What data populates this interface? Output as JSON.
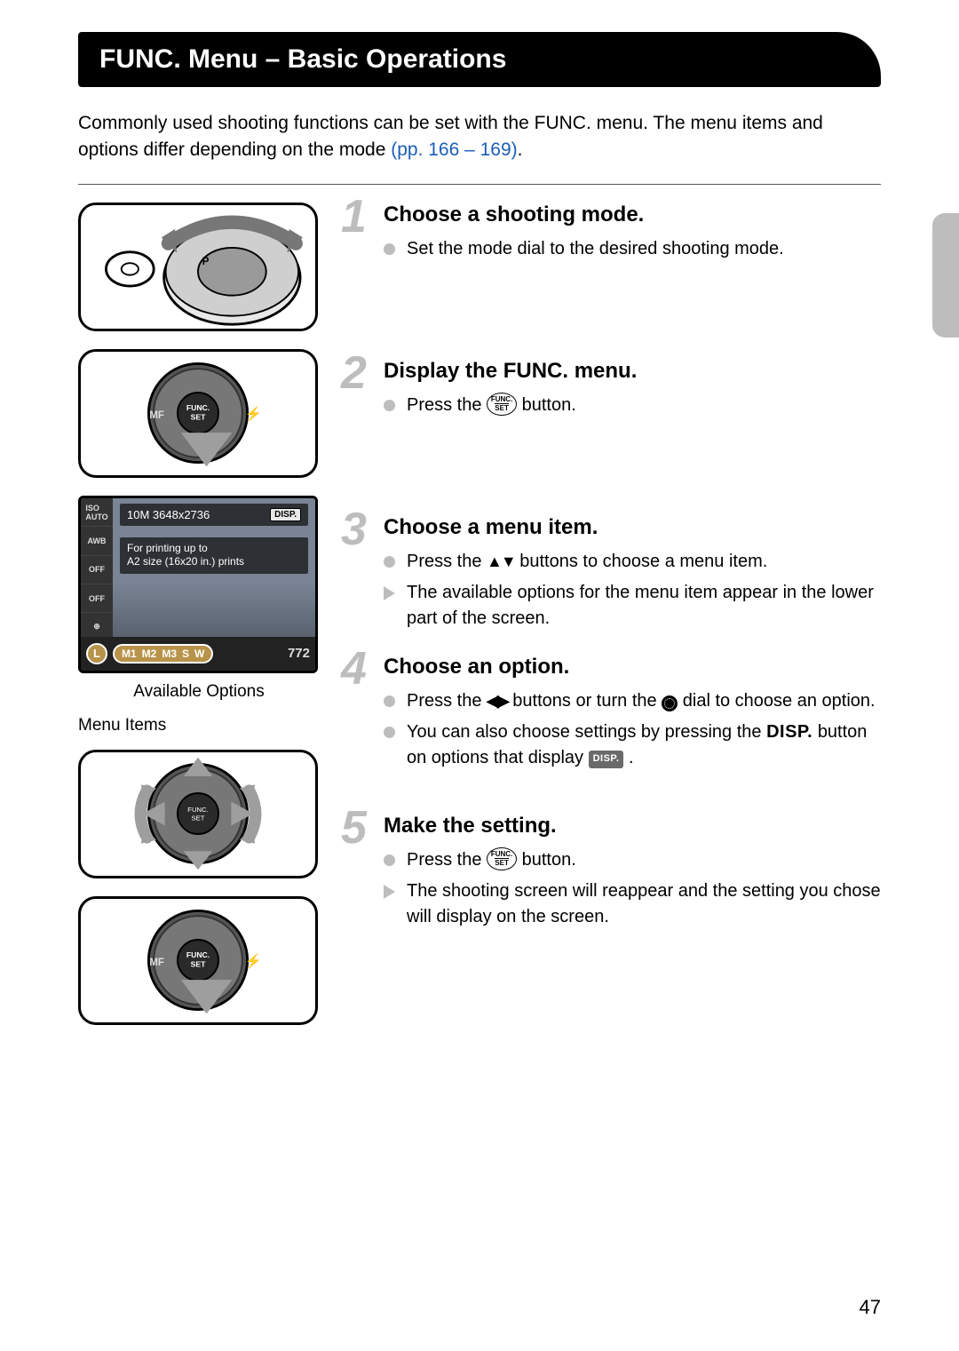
{
  "title": "FUNC. Menu – Basic Operations",
  "intro_a": "Commonly used shooting functions can be set with the FUNC. menu. The menu items and options differ depending on the mode ",
  "intro_link": "(pp. 166 – 169)",
  "intro_b": ".",
  "left": {
    "available_options": "Available Options",
    "menu_items": "Menu Items",
    "screen": {
      "side_items": [
        "ISO\nAUTO",
        "AWB",
        "OFF",
        "OFF",
        "⊕",
        "□"
      ],
      "res_line": "10M 3648x2736",
      "disp_label": "DISP.",
      "desc1": "For printing up to",
      "desc2": "A2 size (16x20 in.) prints",
      "L": "L",
      "sizes": [
        "M1",
        "M2",
        "M3",
        "S",
        "W"
      ],
      "count": "772"
    }
  },
  "steps": [
    {
      "num": "1",
      "title": "Choose a shooting mode.",
      "items": [
        {
          "type": "circle",
          "text": "Set the mode dial to the desired shooting mode."
        }
      ]
    },
    {
      "num": "2",
      "title": "Display the FUNC. menu.",
      "items": [
        {
          "type": "circle",
          "text_pre": "Press the ",
          "icon": "func",
          "text_post": " button."
        }
      ]
    },
    {
      "num": "3",
      "title": "Choose a menu item.",
      "items": [
        {
          "type": "circle",
          "text_pre": "Press the ",
          "icon": "updown",
          "text_post": " buttons to choose a menu item."
        },
        {
          "type": "tri",
          "text": "The available options for the menu item appear in the lower part of the screen."
        }
      ]
    },
    {
      "num": "4",
      "title": "Choose an option.",
      "items": [
        {
          "type": "circle",
          "text_pre": "Press the ",
          "icon": "leftright",
          "text_mid": " buttons or turn the ",
          "icon2": "dial",
          "text_post": " dial to choose an option."
        },
        {
          "type": "circle",
          "text_pre": "You can also choose settings by pressing the ",
          "icon": "disptext",
          "text_mid": " button on options that display ",
          "icon2": "dispbadge",
          "text_post": " ."
        }
      ]
    },
    {
      "num": "5",
      "title": "Make the setting.",
      "items": [
        {
          "type": "circle",
          "text_pre": "Press the ",
          "icon": "func",
          "text_post": " button."
        },
        {
          "type": "tri",
          "text": "The shooting screen will reappear and the setting you chose will display on the screen."
        }
      ]
    }
  ],
  "page_number": "47"
}
